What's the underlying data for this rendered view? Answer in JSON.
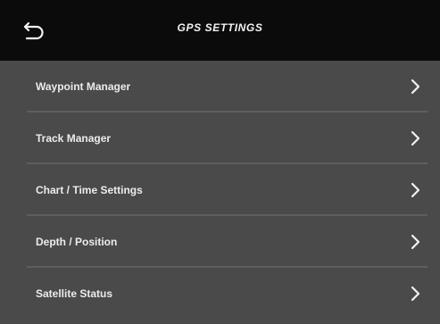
{
  "header": {
    "title": "GPS SETTINGS",
    "back_icon": "back-arrow-icon"
  },
  "menu": {
    "items": [
      {
        "label": "Waypoint Manager",
        "icon": "chevron-right-icon"
      },
      {
        "label": "Track Manager",
        "icon": "chevron-right-icon"
      },
      {
        "label": "Chart / Time Settings",
        "icon": "chevron-right-icon"
      },
      {
        "label": "Depth / Position",
        "icon": "chevron-right-icon"
      },
      {
        "label": "Satellite Status",
        "icon": "chevron-right-icon"
      }
    ]
  },
  "colors": {
    "header_bg": "#0b0b0b",
    "list_bg": "#4a4a4a",
    "divider": "#5e5e5e",
    "text": "#ececec"
  }
}
